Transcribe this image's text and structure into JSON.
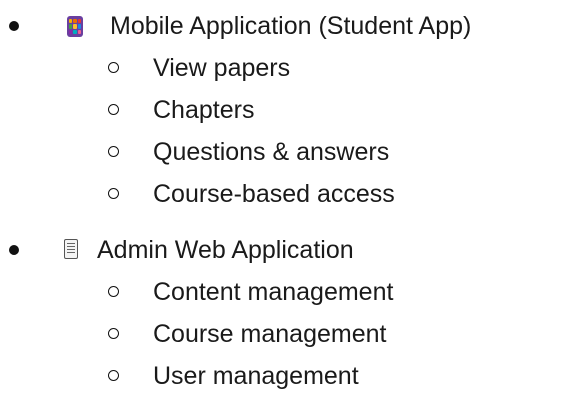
{
  "list": {
    "items": [
      {
        "icon": "mobile-app-icon",
        "label": "Mobile Application (Student App)",
        "subitems": [
          "View papers",
          "Chapters",
          "Questions & answers",
          "Course-based access"
        ]
      },
      {
        "icon": "document-icon",
        "label": "Admin Web Application",
        "subitems": [
          "Content management",
          "Course management",
          "User management"
        ]
      }
    ]
  }
}
